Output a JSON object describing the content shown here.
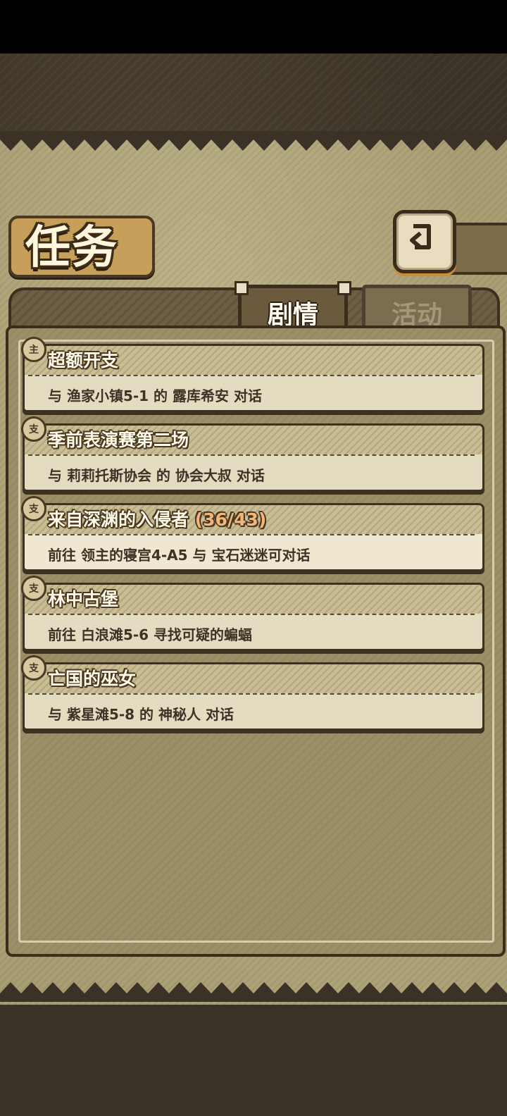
{
  "screen": {
    "title": "任务",
    "back_icon": "back-arrow-icon"
  },
  "tabs": [
    {
      "label": "剧情",
      "active": true
    },
    {
      "label": "活动",
      "active": false
    }
  ],
  "quests": [
    {
      "type_icon": "主",
      "title": "超额开支",
      "progress": "",
      "desc": "与 渔家小镇5-1 的 露库希安 对话"
    },
    {
      "type_icon": "支",
      "title": "季前表演赛第二场",
      "progress": "",
      "desc": "与 莉莉托斯协会 的 协会大叔 对话"
    },
    {
      "type_icon": "支",
      "title": "来自深渊的入侵者",
      "progress": "(36/43)",
      "desc": "前往 领主的寝宫4-A5 与 宝石迷迷可对话"
    },
    {
      "type_icon": "支",
      "title": "林中古堡",
      "progress": "",
      "desc": "前往 白浪滩5-6 寻找可疑的蝙蝠"
    },
    {
      "type_icon": "支",
      "title": "亡国的巫女",
      "progress": "",
      "desc": "与 紫星滩5-8 的 神秘人 对话"
    }
  ],
  "colors": {
    "parchment": "#a99d73",
    "outline": "#3a2e1d",
    "progress": "#f3b679"
  }
}
